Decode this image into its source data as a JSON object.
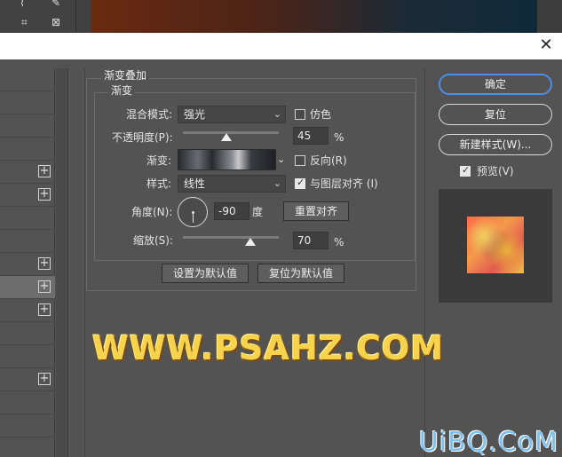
{
  "dialog": {
    "close_icon": "close-icon"
  },
  "gradient_overlay": {
    "group_title": "渐变叠加",
    "sub_title": "渐变",
    "blend_mode_label": "混合模式:",
    "blend_mode_value": "强光",
    "dither_label": "仿色",
    "dither_checked": false,
    "opacity_label": "不透明度(P):",
    "opacity_value": "45",
    "opacity_unit": "%",
    "opacity_fraction": 0.45,
    "gradient_label": "渐变:",
    "reverse_label": "反向(R)",
    "reverse_checked": false,
    "style_label": "样式:",
    "style_value": "线性",
    "align_label": "与图层对齐 (I)",
    "align_checked": true,
    "angle_label": "角度(N):",
    "angle_value": "-90",
    "angle_unit": "度",
    "reset_align_button": "重置对齐",
    "scale_label": "缩放(S):",
    "scale_value": "70",
    "scale_unit": "%",
    "scale_fraction": 0.7,
    "set_default_button": "设置为默认值",
    "reset_default_button": "复位为默认值"
  },
  "side_buttons": {
    "ok": "确定",
    "reset": "复位",
    "new_style": "新建样式(W)...",
    "preview_label": "预览(V)",
    "preview_checked": true
  },
  "left_list": {
    "plus_icon": "plus-icon",
    "plus_symbol": "+"
  },
  "watermarks": {
    "main": "WWW.PSAHZ.COM",
    "corner": "UiBQ.CoM"
  }
}
